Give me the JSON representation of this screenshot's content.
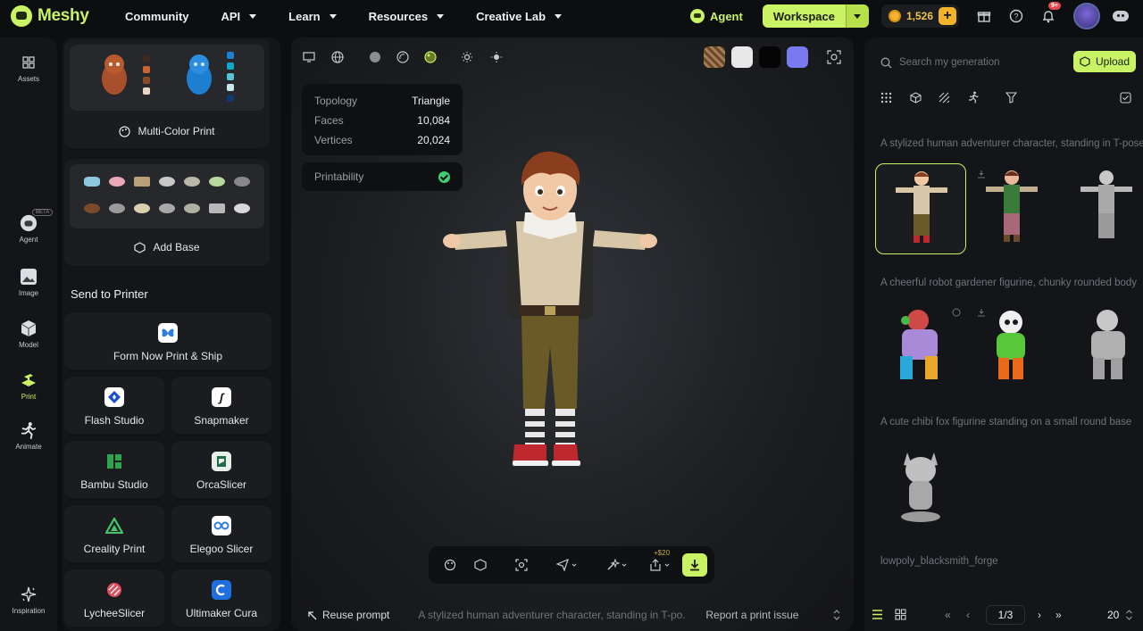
{
  "brand": {
    "name": "Meshy"
  },
  "nav": [
    {
      "label": "Community",
      "has_menu": false
    },
    {
      "label": "API",
      "has_menu": true
    },
    {
      "label": "Learn",
      "has_menu": true
    },
    {
      "label": "Resources",
      "has_menu": true
    },
    {
      "label": "Creative Lab",
      "has_menu": true
    }
  ],
  "header": {
    "agent_label": "Agent",
    "workspace_label": "Workspace",
    "credits": "1,526",
    "notification_badge": "9+"
  },
  "rail": [
    {
      "label": "Assets",
      "icon": "grid-icon"
    },
    {
      "label": "Agent",
      "icon": "agent-icon",
      "beta": "BETA"
    },
    {
      "label": "Image",
      "icon": "image-icon"
    },
    {
      "label": "Model",
      "icon": "cube-icon"
    },
    {
      "label": "Print",
      "icon": "print-icon",
      "active": true
    },
    {
      "label": "Animate",
      "icon": "running-icon"
    },
    {
      "label": "Inspiration",
      "icon": "sparkle-icon"
    }
  ],
  "left_panel": {
    "multicolor_label": "Multi-Color Print",
    "add_base_label": "Add Base",
    "send_to_printer": "Send to Printer",
    "form_now": "Form Now Print & Ship",
    "slicers": [
      {
        "name": "Flash Studio",
        "color": "#ffffff",
        "bg": "#1a4fd0"
      },
      {
        "name": "Snapmaker",
        "color": "#111111",
        "bg": "#ffffff"
      },
      {
        "name": "Bambu Studio",
        "color": "#2ea44f",
        "bg": "#1b1c1f"
      },
      {
        "name": "OrcaSlicer",
        "color": "#ffffff",
        "bg": "#1f6b4a"
      },
      {
        "name": "Creality Print",
        "color": "#46c36b",
        "bg": "#1b1c1f"
      },
      {
        "name": "Elegoo Slicer",
        "color": "#2f7fe0",
        "bg": "#ffffff"
      },
      {
        "name": "LycheeSlicer",
        "color": "#e04d5a",
        "bg": "#1b1c1f"
      },
      {
        "name": "Ultimaker Cura",
        "color": "#1f6fe0",
        "bg": "#ffffff"
      }
    ]
  },
  "viewport": {
    "stats": [
      {
        "key": "Topology",
        "value": "Triangle"
      },
      {
        "key": "Faces",
        "value": "10,084"
      },
      {
        "key": "Vertices",
        "value": "20,024"
      }
    ],
    "printability_label": "Printability",
    "share_bonus": "+$20",
    "reuse_prompt": "Reuse prompt",
    "prompt_text": "A stylized human adventurer character, standing in T-po...",
    "report_issue": "Report a print issue"
  },
  "right_panel": {
    "search_placeholder": "Search my generation",
    "upload_label": "Upload",
    "generations": [
      {
        "title": "A stylized human adventurer character, standing in T-pose"
      },
      {
        "title": "A cheerful robot gardener figurine, chunky rounded body"
      },
      {
        "title": "A cute chibi fox figurine standing on a small round base"
      },
      {
        "title": "lowpoly_blacksmith_forge"
      }
    ],
    "page": "1/3",
    "per_page": "20"
  }
}
